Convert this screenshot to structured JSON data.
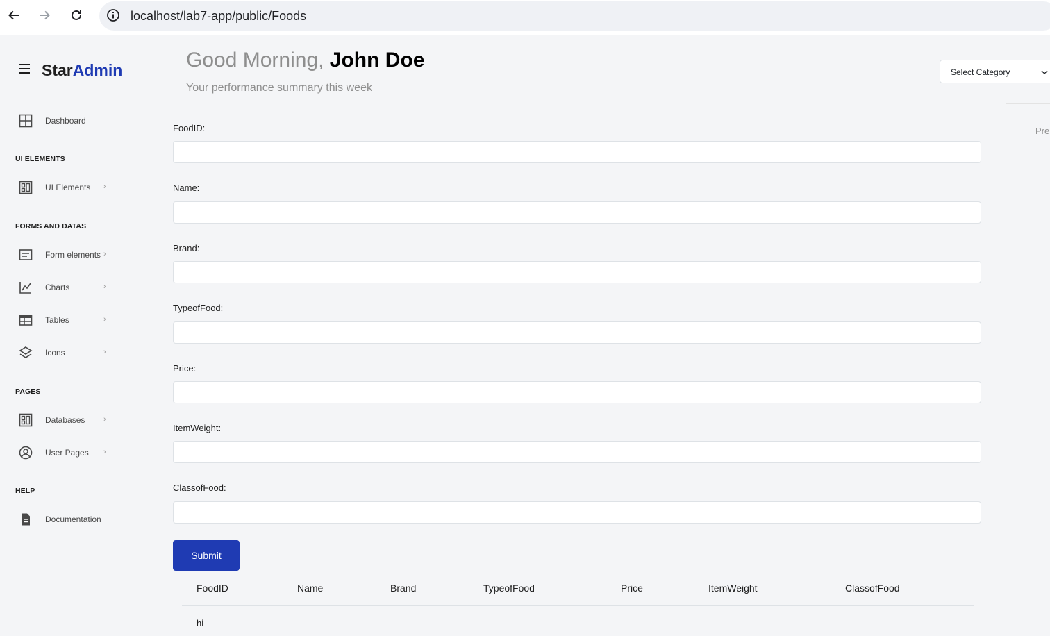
{
  "browser": {
    "url": "localhost/lab7-app/public/Foods"
  },
  "sidebar": {
    "brand_a": "Star",
    "brand_b": "Admin",
    "dashboard": "Dashboard",
    "sections": {
      "ui": "UI ELEMENTS",
      "forms": "FORMS AND DATAS",
      "pages": "PAGES",
      "help": "HELP"
    },
    "items": {
      "ui_elements": "UI Elements",
      "form_elements": "Form elements",
      "charts": "Charts",
      "tables": "Tables",
      "icons": "Icons",
      "databases": "Databases",
      "user_pages": "User Pages",
      "documentation": "Documentation"
    },
    "chevron": "›"
  },
  "header": {
    "greeting": "Good Morning,",
    "user": "John Doe",
    "subtitle": "Your performance summary this week",
    "select_category": "Select Category",
    "pre_text": "Pren"
  },
  "form": {
    "labels": {
      "foodid": "FoodID:",
      "name": "Name:",
      "brand": "Brand:",
      "typeoffood": "TypeofFood:",
      "price": "Price:",
      "itemweight": "ItemWeight:",
      "classoffood": "ClassofFood:"
    },
    "values": {
      "foodid": "",
      "name": "",
      "brand": "",
      "typeoffood": "",
      "price": "",
      "itemweight": "",
      "classoffood": ""
    },
    "submit": "Submit"
  },
  "table": {
    "headers": [
      "FoodID",
      "Name",
      "Brand",
      "TypeofFood",
      "Price",
      "ItemWeight",
      "ClassofFood"
    ],
    "rows": [
      [
        "hi",
        "",
        "",
        "",
        "",
        "",
        ""
      ]
    ]
  }
}
